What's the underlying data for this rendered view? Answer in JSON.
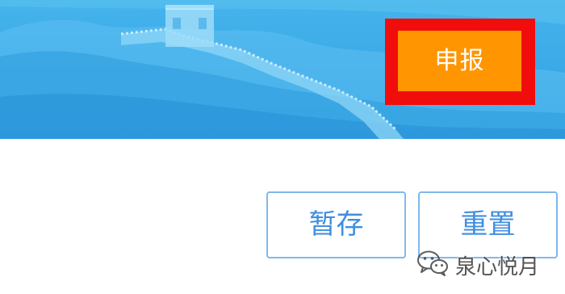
{
  "banner": {
    "submit_label": "申报"
  },
  "actions": {
    "save_draft_label": "暂存",
    "reset_label": "重置"
  },
  "watermark": {
    "text": "泉心悦月",
    "icon": "wechat-icon"
  },
  "colors": {
    "banner_blue": "#3aa8e6",
    "submit_orange": "#ff9500",
    "highlight_red": "#f20d0d",
    "outline_blue": "#7fb8ec",
    "text_blue": "#3f8ee0"
  }
}
